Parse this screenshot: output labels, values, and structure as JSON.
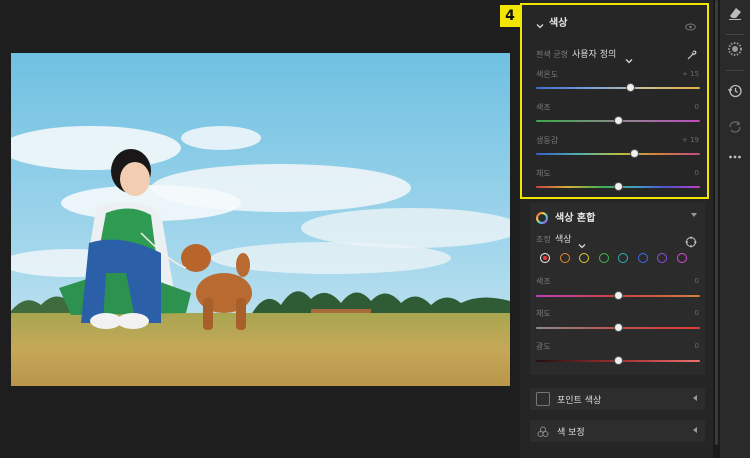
{
  "badge": "4",
  "color_section": {
    "title": "색상",
    "white_balance_label": "흰색 균형",
    "white_balance_value": "사용자 정의",
    "sliders": [
      {
        "label": "색온도",
        "value": "+ 15",
        "level": 0.62
      },
      {
        "label": "색조",
        "value": "0",
        "level": 0.5
      },
      {
        "label": "생동감",
        "value": "+ 19",
        "level": 0.65
      },
      {
        "label": "채도",
        "value": "0",
        "level": 0.5
      }
    ]
  },
  "color_mix": {
    "title": "색상 혼합",
    "adjust_label": "조정",
    "adjust_value": "색상",
    "swatches": [
      "#e53b3b",
      "#e8892c",
      "#d9cf2c",
      "#3fb84a",
      "#2ab3b0",
      "#3a6be8",
      "#8a4de8",
      "#d84ad8"
    ],
    "sliders": [
      {
        "label": "색조",
        "value": "0",
        "level": 0.5
      },
      {
        "label": "채도",
        "value": "0",
        "level": 0.5
      },
      {
        "label": "광도",
        "value": "0",
        "level": 0.5
      }
    ]
  },
  "point_color": {
    "title": "포인트 색상"
  },
  "color_grading": {
    "title": "색 보정"
  }
}
